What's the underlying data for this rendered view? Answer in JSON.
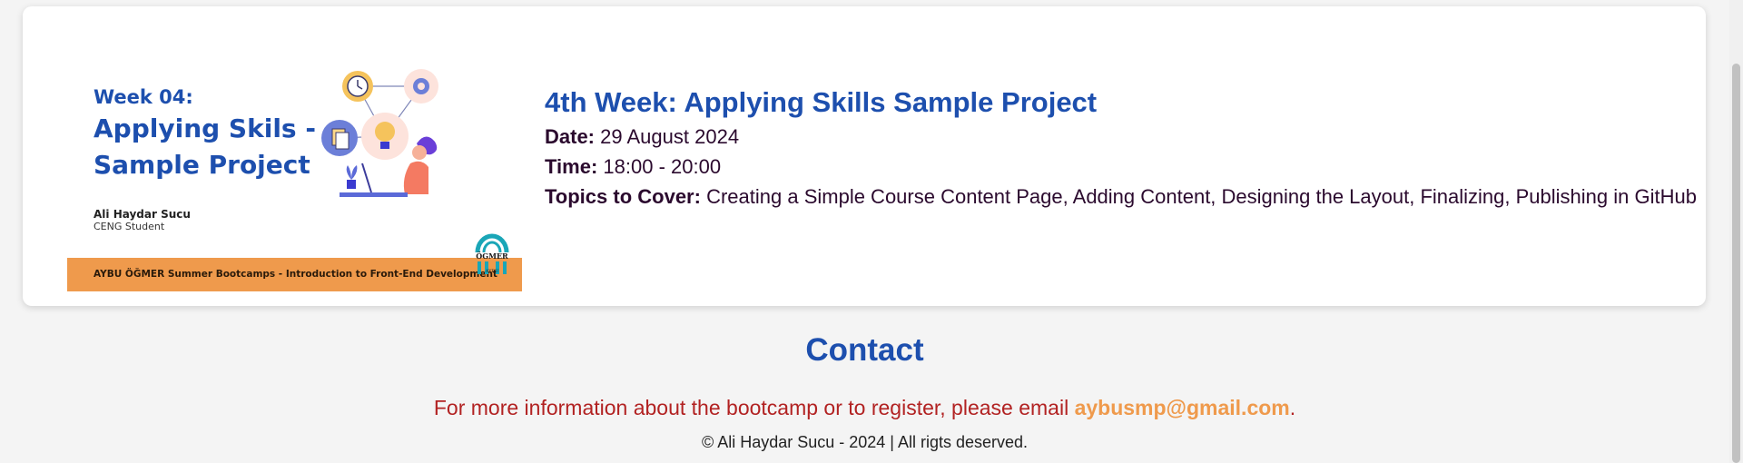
{
  "banner": {
    "week": "Week 04:",
    "title": "Applying Skils - Sample Project",
    "author": "Ali Haydar Sucu",
    "role": "CENG Student",
    "strip": "AYBU ÖĞMER Summer Bootcamps - Introduction to Front-End Development",
    "logo_text": "ÖGMER",
    "logo_sub": "AYBU"
  },
  "session": {
    "title": "4th Week: Applying Skills Sample Project",
    "date_label": "Date:",
    "date": "29 August 2024",
    "time_label": "Time:",
    "time": "18:00 - 20:00",
    "topics_label": "Topics to Cover:",
    "topics": "Creating a Simple Course Content Page, Adding Content, Designing the Layout, Finalizing, Publishing in GitHub"
  },
  "contact": {
    "title": "Contact",
    "text": "For more information about the bootcamp or to register, please email ",
    "email": "aybusmp@gmail.com",
    "end": "."
  },
  "footer": {
    "text": "© Ali Haydar Sucu - 2024 | All rigts deserved."
  },
  "colors": {
    "accent_blue": "#1d4fae",
    "accent_orange": "#ef9a4c",
    "contact_red": "#b22222",
    "text_dark": "#2b0a2e"
  }
}
